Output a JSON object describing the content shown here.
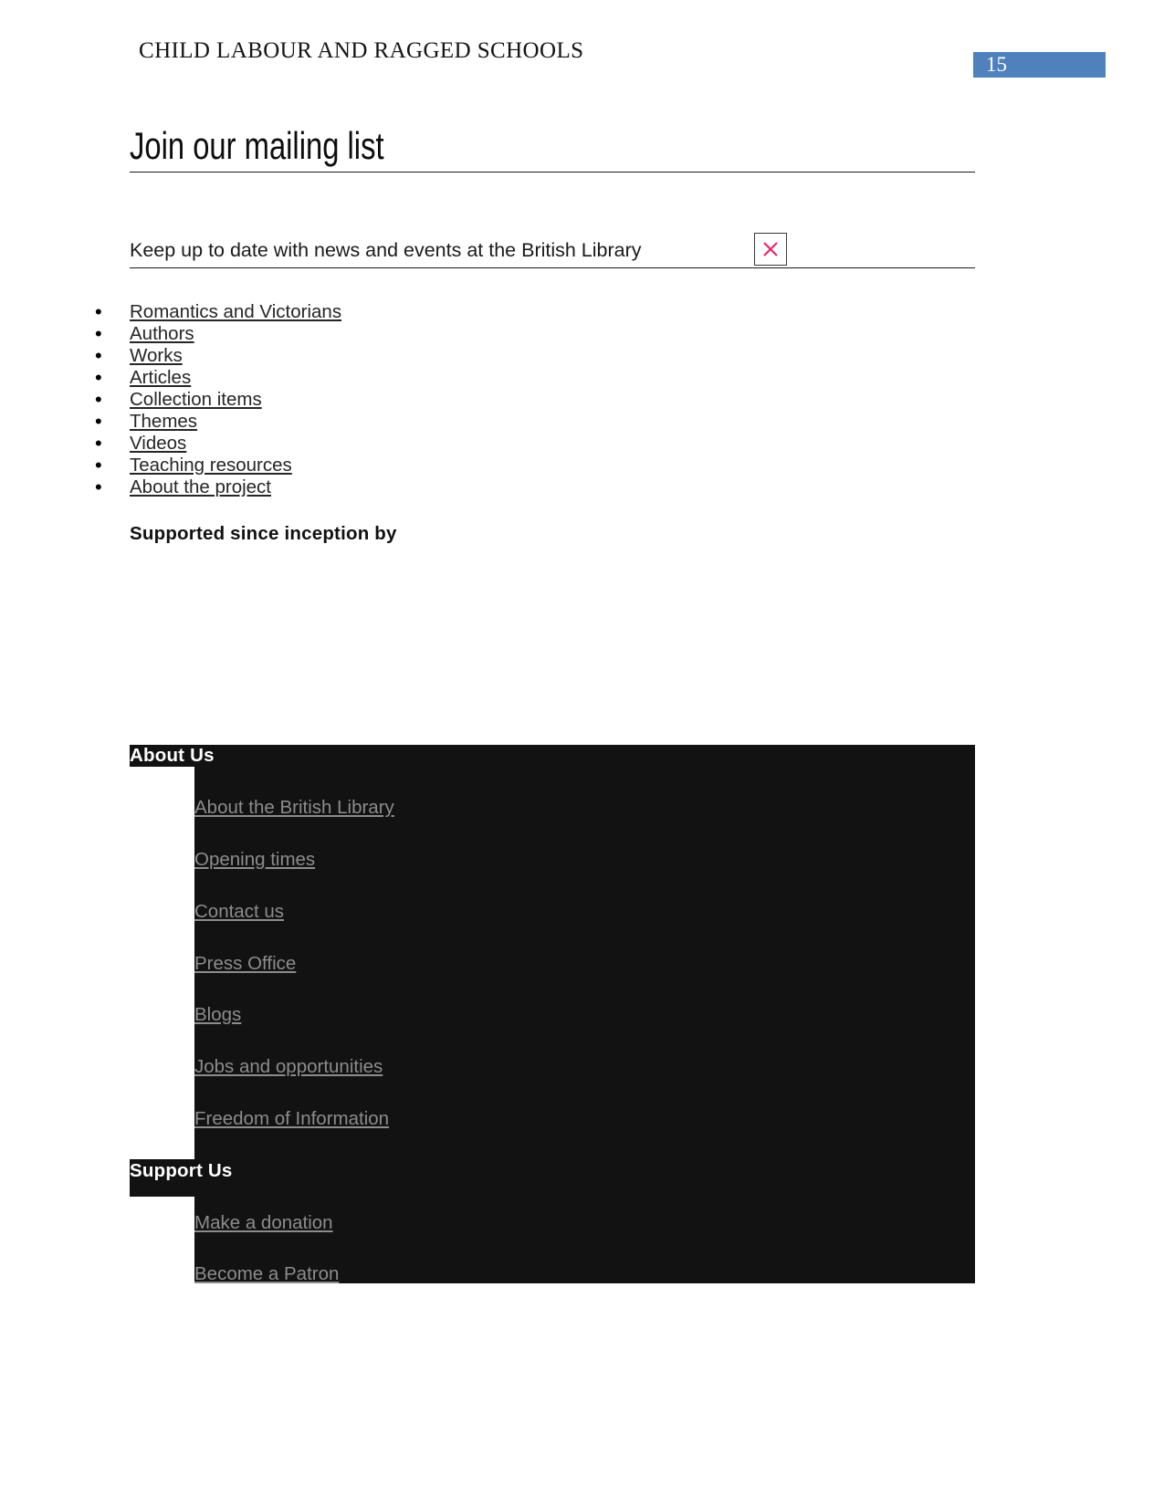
{
  "header": {
    "running_title": "CHILD LABOUR AND RAGGED SCHOOLS",
    "page_number": "15",
    "badge_color": "#4f81bd"
  },
  "main": {
    "title": "Join our mailing list",
    "subscribe_text": "Keep up to date with news and events at the British Library",
    "broken_image_icon": "broken-image-icon",
    "broken_image_x_color": "#e8276a",
    "nav_links": [
      {
        "label": "Romantics and Victorians"
      },
      {
        "label": "Authors"
      },
      {
        "label": "Works"
      },
      {
        "label": "Articles"
      },
      {
        "label": "Collection items"
      },
      {
        "label": "Themes"
      },
      {
        "label": "Videos"
      },
      {
        "label": "Teaching resources"
      },
      {
        "label": "About the project"
      }
    ],
    "supported_heading": "Supported since inception by"
  },
  "footer": {
    "background_color": "#121212",
    "link_color": "#8c8c8c",
    "sections": [
      {
        "heading": "About Us",
        "links": [
          {
            "label": "About the British Library"
          },
          {
            "label": "Opening times"
          },
          {
            "label": "Contact us"
          },
          {
            "label": "Press Office"
          },
          {
            "label": "Blogs"
          },
          {
            "label": "Jobs and opportunities"
          },
          {
            "label": "Freedom of Information"
          }
        ]
      },
      {
        "heading": "Support Us",
        "links": [
          {
            "label": "Make a donation"
          },
          {
            "label": "Become a Patron"
          }
        ]
      }
    ]
  }
}
